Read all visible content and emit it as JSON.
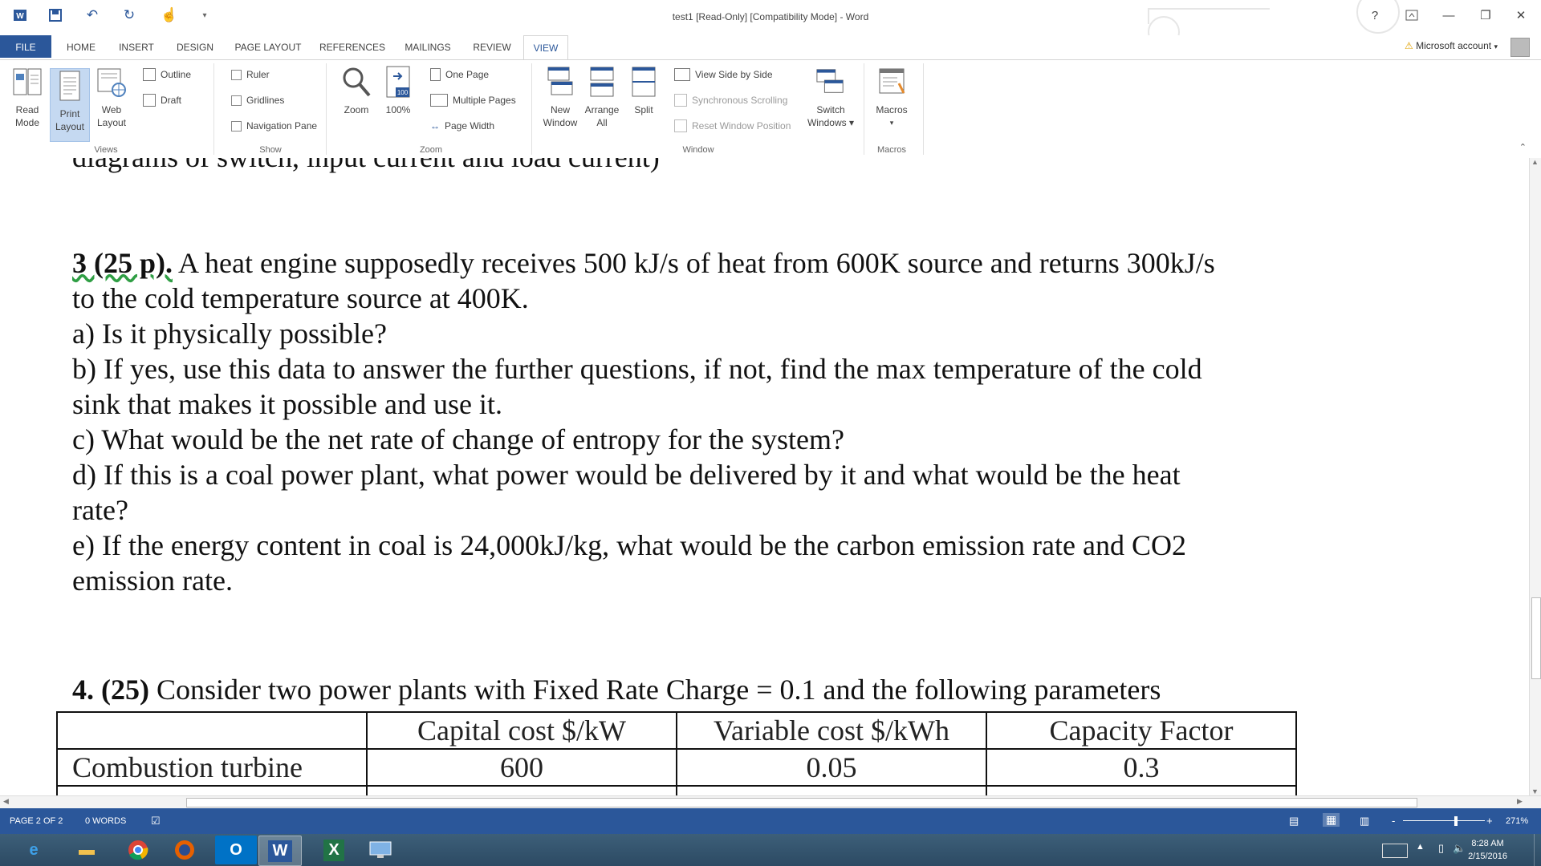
{
  "window": {
    "title": "test1 [Read-Only] [Compatibility Mode] - Word",
    "help": "?",
    "controls": {
      "minimize": "—",
      "restore": "❐",
      "close": "✕"
    }
  },
  "tabs": [
    "FILE",
    "HOME",
    "INSERT",
    "DESIGN",
    "PAGE LAYOUT",
    "REFERENCES",
    "MAILINGS",
    "REVIEW",
    "VIEW"
  ],
  "account": "Microsoft account",
  "ribbon": {
    "views": {
      "label": "Views",
      "read_mode": [
        "Read",
        "Mode"
      ],
      "print_layout": [
        "Print",
        "Layout"
      ],
      "web_layout": [
        "Web",
        "Layout"
      ],
      "outline": "Outline",
      "draft": "Draft"
    },
    "show": {
      "label": "Show",
      "ruler": "Ruler",
      "gridlines": "Gridlines",
      "navigation_pane": "Navigation Pane"
    },
    "zoom": {
      "label": "Zoom",
      "zoom": "Zoom",
      "pct": "100%",
      "icon_badge": "100",
      "one_page": "One Page",
      "multiple_pages": "Multiple Pages",
      "page_width": "Page Width"
    },
    "window": {
      "label": "Window",
      "new_window": [
        "New",
        "Window"
      ],
      "arrange_all": [
        "Arrange",
        "All"
      ],
      "split": "Split",
      "view_side_by_side": "View Side by Side",
      "synchronous_scrolling": "Synchronous Scrolling",
      "reset_window_position": "Reset Window Position",
      "switch_windows": [
        "Switch",
        "Windows ▾"
      ]
    },
    "macros": {
      "label": "Macros",
      "macros": "Macros"
    }
  },
  "document": {
    "cutoff_line": "diagrams of switch, input current and load current)",
    "q3_number": "3 (25 p).",
    "q3_lines": [
      "A heat engine supposedly receives 500 kJ/s of heat from 600K source and returns 300kJ/s",
      "to the cold temperature source at 400K.",
      "a) Is it physically possible?",
      "b) If yes, use this data to answer the further questions, if not, find the max temperature of the cold",
      "sink that makes it possible and use it.",
      "c) What would be the net rate of change of entropy for the system?",
      "d) If this is a coal power plant, what power would be delivered by it and what would be the heat",
      "rate?",
      "e) If the energy content in coal is 24,000kJ/kg, what would be the carbon emission rate and CO2",
      "emission rate."
    ],
    "q4_number": "4. (25)",
    "q4_text": "Consider two power plants with Fixed Rate Charge = 0.1 and the following parameters",
    "table": {
      "headers": [
        "",
        "Capital cost $/kW",
        "Variable cost $/kWh",
        "Capacity Factor"
      ],
      "rows": [
        [
          "Combustion turbine",
          "600",
          "0.05",
          "0.3"
        ]
      ]
    }
  },
  "status": {
    "page": "PAGE 2 OF 2",
    "words": "0 WORDS",
    "zoom_minus": "-",
    "zoom_plus": "+",
    "zoom_level": "271%"
  },
  "taskbar": {
    "time": "8:28 AM",
    "date": "2/15/2016"
  },
  "colors": {
    "accent": "#2b579a",
    "ribbon_selected": "#c5d9f1"
  }
}
